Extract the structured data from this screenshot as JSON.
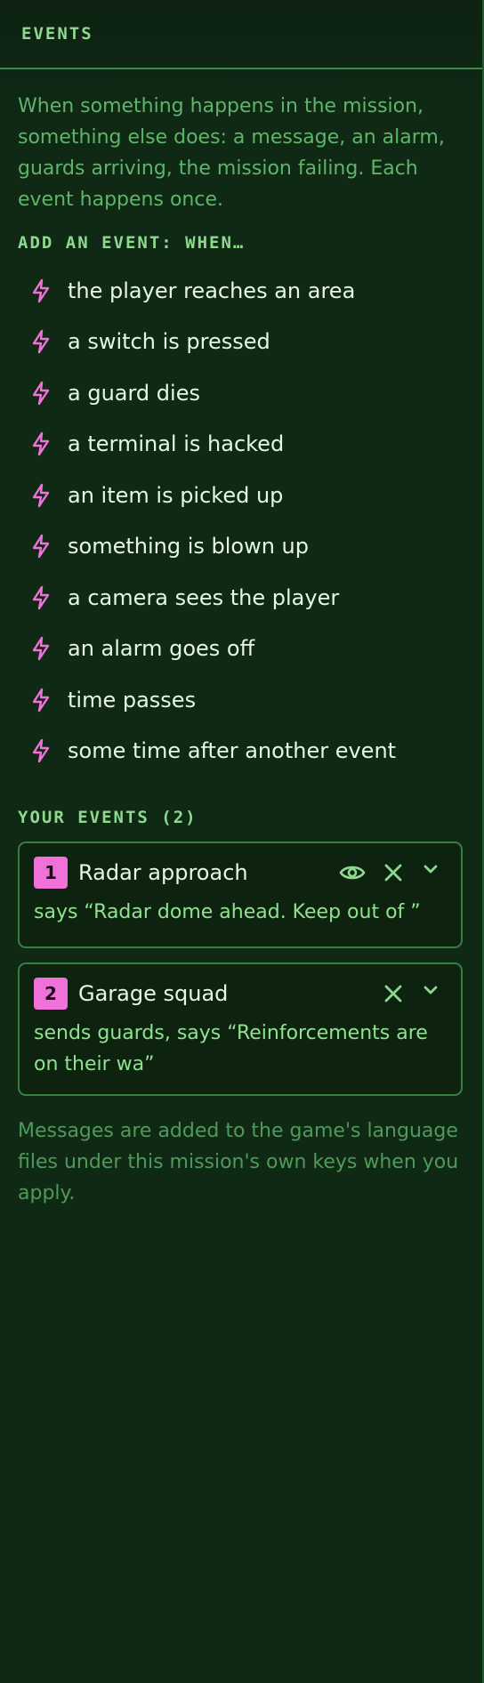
{
  "header": {
    "title": "EVENTS"
  },
  "intro": "When something happens in the mission, something else does: a message, an alarm, guards arriving, the mission failing. Each event happens once.",
  "add_section": {
    "label": "ADD AN EVENT: WHEN…",
    "icon": "lightning-bolt-icon",
    "triggers": [
      {
        "label": "the player reaches an area"
      },
      {
        "label": "a switch is pressed"
      },
      {
        "label": "a guard dies"
      },
      {
        "label": "a terminal is hacked"
      },
      {
        "label": "an item is picked up"
      },
      {
        "label": "something is blown up"
      },
      {
        "label": "a camera sees the player"
      },
      {
        "label": "an alarm goes off"
      },
      {
        "label": "time passes"
      },
      {
        "label": "some time after another event"
      }
    ]
  },
  "events_section": {
    "label": "YOUR EVENTS (2)",
    "events": [
      {
        "number": "1",
        "name": "Radar approach",
        "description": "says “Radar dome ahead. Keep out of ”",
        "icons": [
          "eye-icon",
          "close-icon",
          "chevron-down-icon"
        ]
      },
      {
        "number": "2",
        "name": "Garage squad",
        "description": "sends guards, says “Reinforcements are on their wa”",
        "icons": [
          "close-icon",
          "chevron-down-icon"
        ]
      }
    ]
  },
  "footer_note": "Messages are added to the game's language files under this mission's own keys when you apply.",
  "colors": {
    "background": "#0f2915",
    "accent_green": "#8fd88f",
    "muted_green": "#5eb56a",
    "pink_accent": "#f072d8",
    "text": "#e6f5e6"
  }
}
